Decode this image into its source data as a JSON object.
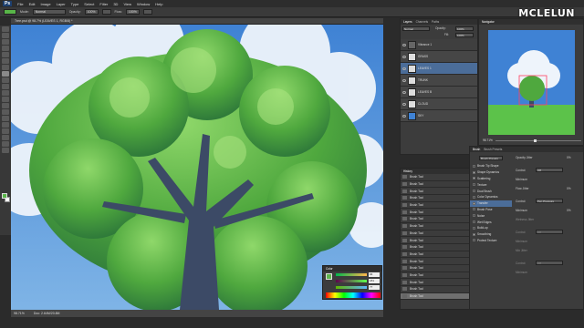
{
  "app": {
    "logo": "Ps",
    "menus": [
      "File",
      "Edit",
      "Image",
      "Layer",
      "Type",
      "Select",
      "Filter",
      "3D",
      "View",
      "Window",
      "Help"
    ],
    "watermark": "MCLELUN"
  },
  "options": {
    "mode_label": "Mode:",
    "mode_value": "Normal",
    "opacity_label": "Opacity:",
    "opacity_value": "100%",
    "flow_label": "Flow:",
    "flow_value": "100%"
  },
  "document": {
    "tab_title": "Tree.psd @ 98.7% (LEAVES 1, RGB/8) *",
    "zoom": "98.71%",
    "doc_size": "Doc: 2.64M/20.8M"
  },
  "layers_panel": {
    "tabs": [
      "Layers",
      "Channels",
      "Paths"
    ],
    "blend_mode": "Normal",
    "opacity_label": "Opacity:",
    "opacity": "100%",
    "fill_label": "Fill:",
    "fill": "100%",
    "layers": [
      {
        "name": "Vibrance 1",
        "selected": false
      },
      {
        "name": "GRASS",
        "selected": false
      },
      {
        "name": "LEAVES 1",
        "selected": true
      },
      {
        "name": "TRUNK",
        "selected": false
      },
      {
        "name": "LEAVES B",
        "selected": false
      },
      {
        "name": "CLOUD",
        "selected": false
      },
      {
        "name": "SKY",
        "selected": false
      }
    ]
  },
  "history_panel": {
    "tab": "History",
    "items": [
      "Brush Tool",
      "Brush Tool",
      "Brush Tool",
      "Brush Tool",
      "Brush Tool",
      "Brush Tool",
      "Brush Tool",
      "Brush Tool",
      "Brush Tool",
      "Brush Tool",
      "Brush Tool",
      "Brush Tool",
      "Brush Tool",
      "Brush Tool",
      "Brush Tool",
      "Brush Tool",
      "Brush Tool",
      "Brush Tool"
    ]
  },
  "navigator_panel": {
    "tab": "Navigator",
    "zoom": "98.71%"
  },
  "brush_panel": {
    "tabs": [
      "Brush",
      "Brush Presets"
    ],
    "preset_button": "Brush Presets",
    "section_title": "Opacity Jitter",
    "section_value": "0%",
    "items": [
      {
        "label": "Brush Tip Shape",
        "checked": false
      },
      {
        "label": "Shape Dynamics",
        "checked": true
      },
      {
        "label": "Scattering",
        "checked": true
      },
      {
        "label": "Texture",
        "checked": false
      },
      {
        "label": "Dual Brush",
        "checked": false
      },
      {
        "label": "Color Dynamics",
        "checked": false
      },
      {
        "label": "Transfer",
        "checked": true
      },
      {
        "label": "Brush Pose",
        "checked": false
      },
      {
        "label": "Noise",
        "checked": false
      },
      {
        "label": "Wet Edges",
        "checked": false
      },
      {
        "label": "Build-up",
        "checked": false
      },
      {
        "label": "Smoothing",
        "checked": true
      },
      {
        "label": "Protect Texture",
        "checked": false
      }
    ],
    "control_label": "Control:",
    "control_value": "Off",
    "min_label": "Minimum",
    "flow_jitter_label": "Flow Jitter",
    "flow_jitter_value": "0%",
    "pen_pressure": "Pen Pressure",
    "min_value": "0%",
    "wetness_label": "Wetness Jitter",
    "mix_label": "Mix Jitter"
  },
  "color_panel": {
    "tab": "Color",
    "r": "94",
    "g": "181",
    "b": "77",
    "fg_color": "#5eb54d"
  }
}
